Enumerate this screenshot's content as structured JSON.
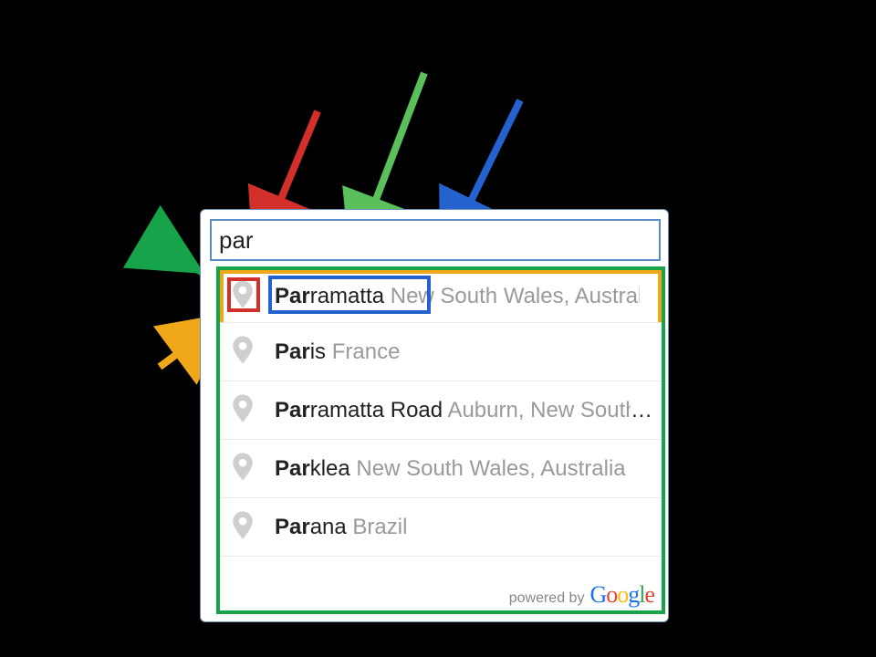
{
  "search": {
    "value": "par"
  },
  "items": [
    {
      "match": "Par",
      "rest": "ramatta",
      "secondary": " New South Wales, Australia"
    },
    {
      "match": "Par",
      "rest": "is",
      "secondary": " France"
    },
    {
      "match": "Par",
      "rest": "ramatta Road",
      "secondary": " Auburn, New South W"
    },
    {
      "match": "Par",
      "rest": "klea",
      "secondary": " New South Wales, Australia"
    },
    {
      "match": "Par",
      "rest": "ana",
      "secondary": " Brazil"
    }
  ],
  "attribution": {
    "prefix": "powered by",
    "logo": "Google"
  },
  "ellipsis": "…",
  "annotation_colors": {
    "container": "#16a34a",
    "row": "#f0a818",
    "icon": "#d4302b",
    "matched": "#2462d0"
  }
}
